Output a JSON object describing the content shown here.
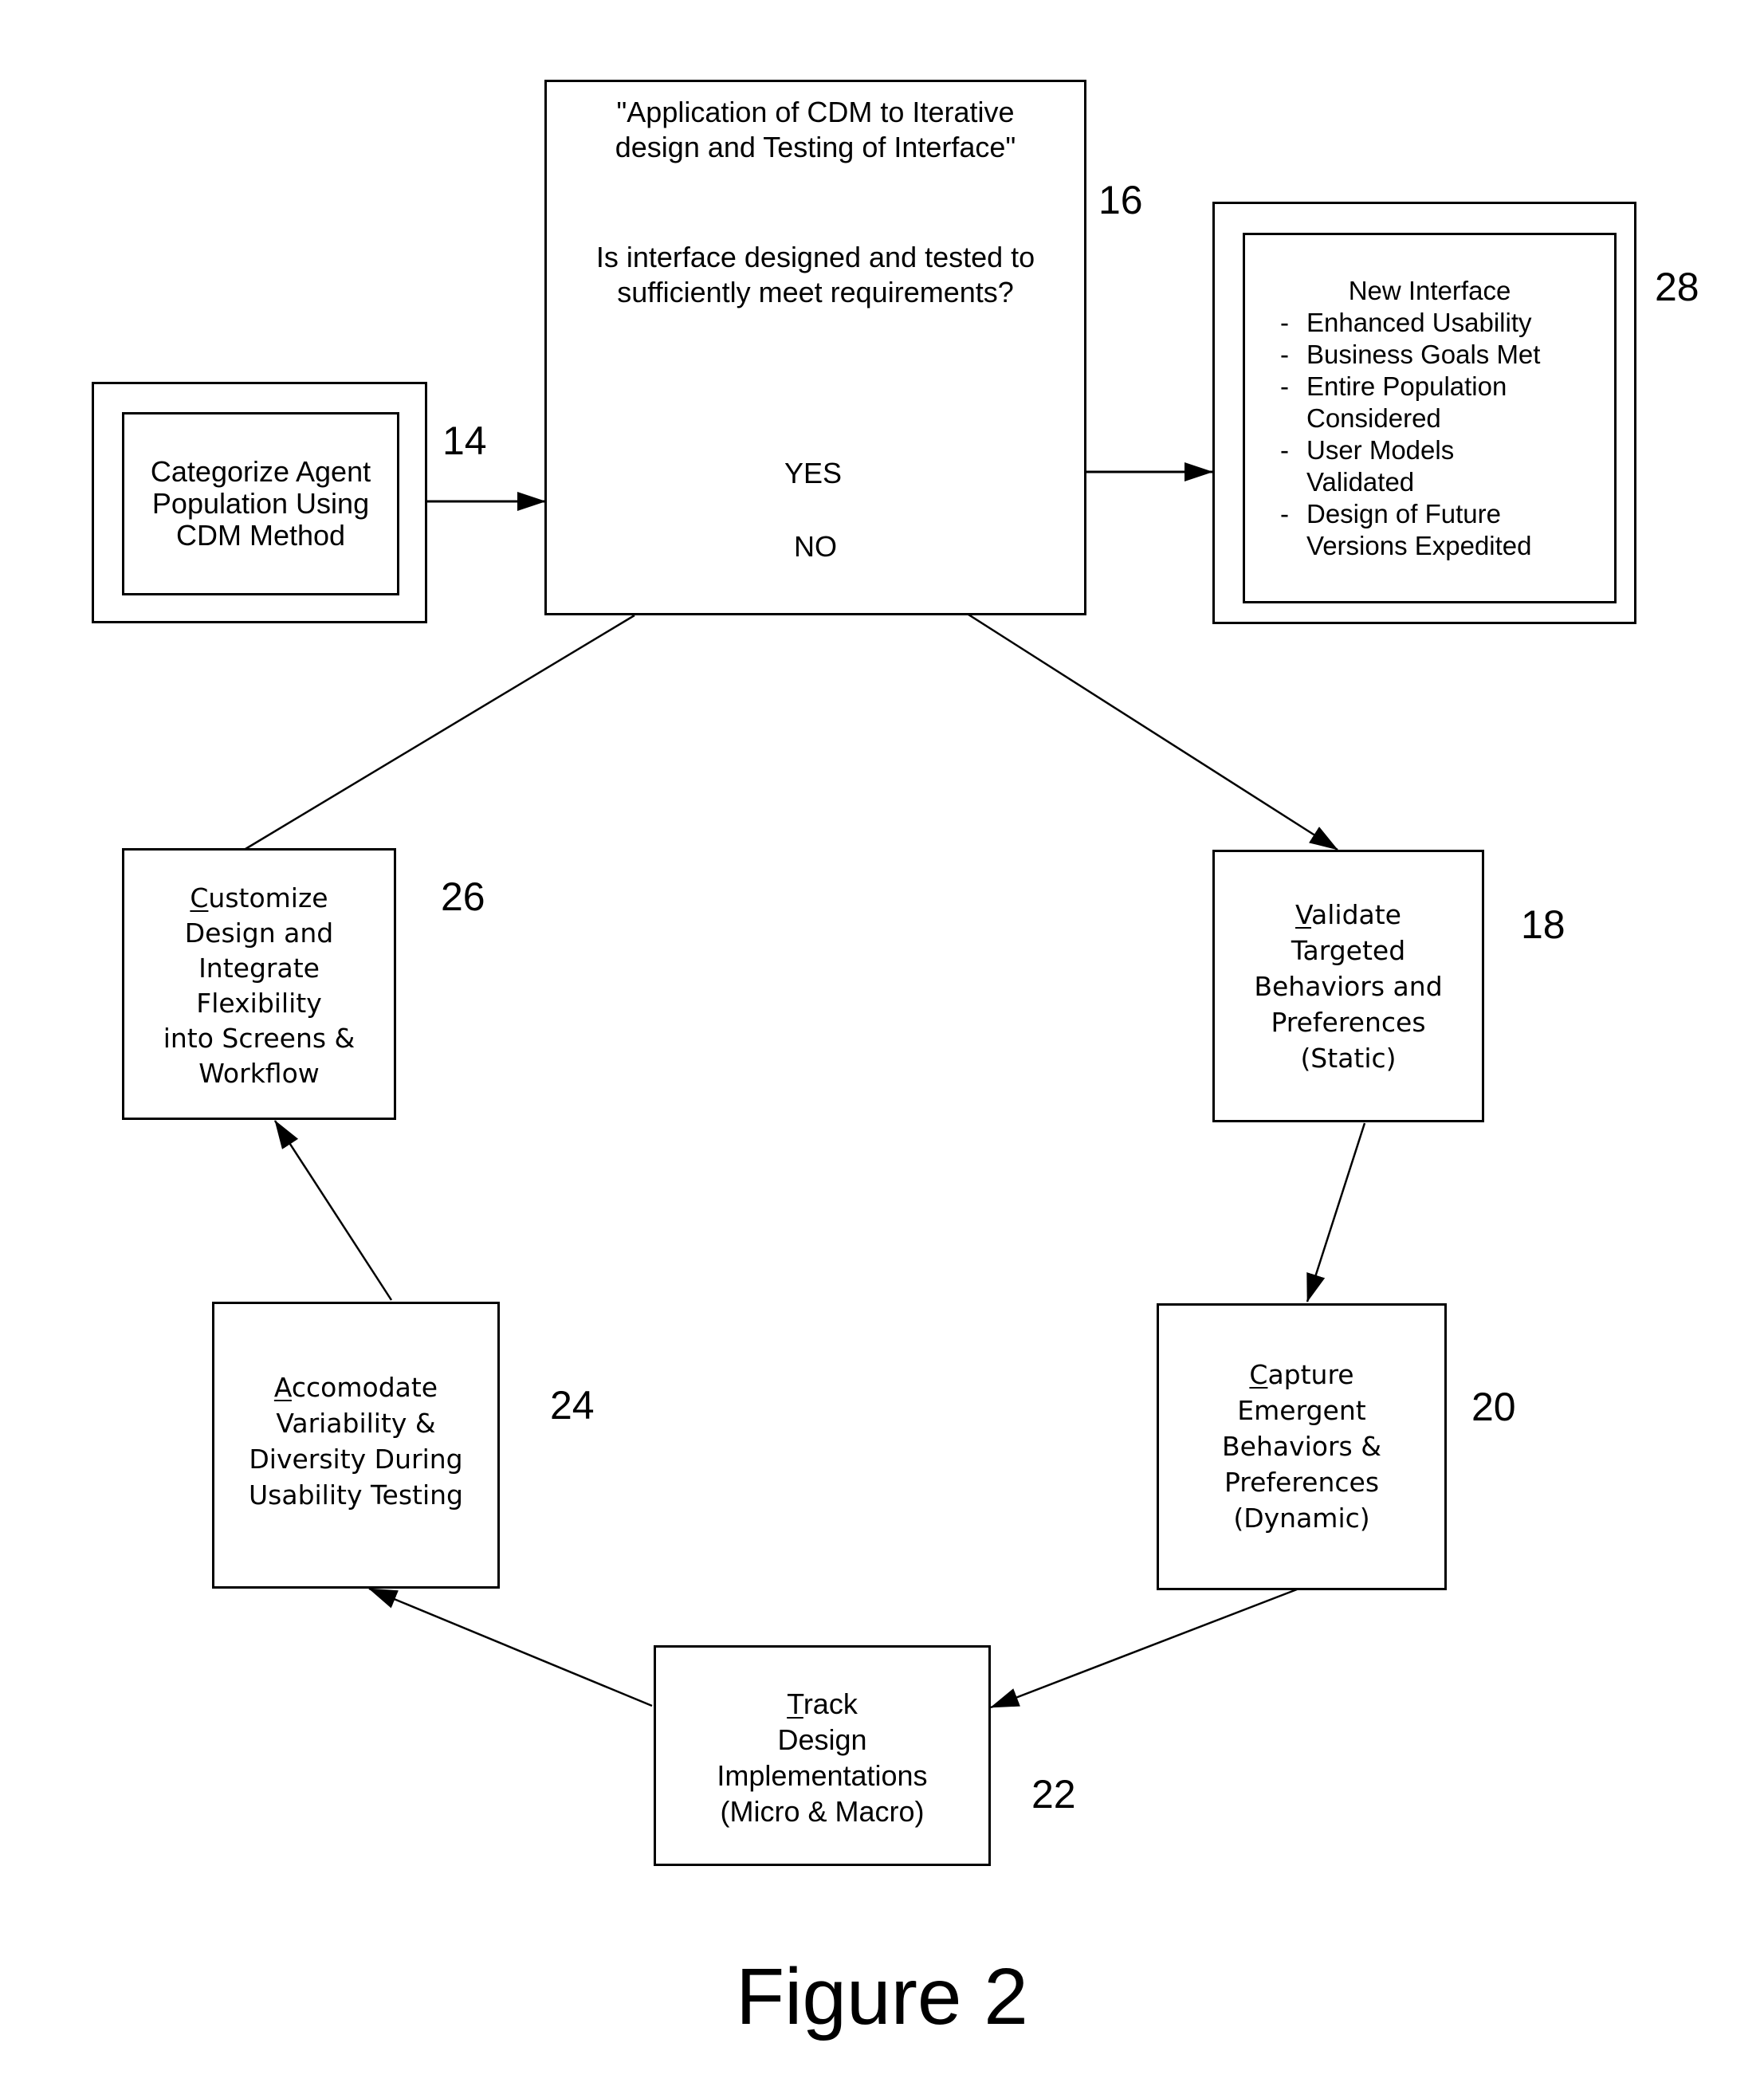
{
  "figure_caption": "Figure 2",
  "nodes": {
    "n14": {
      "ref": "14",
      "lines": [
        "Categorize Agent",
        "Population Using",
        "CDM Method"
      ]
    },
    "n16": {
      "ref": "16",
      "title_lines": [
        "\"Application of CDM to Iterative",
        "design and Testing of Interface\""
      ],
      "question_lines": [
        "Is interface designed and tested to",
        "sufficiently meet requirements?"
      ],
      "yes_label": "YES",
      "no_label": "NO"
    },
    "n28": {
      "ref": "28",
      "heading": "New Interface",
      "items": [
        {
          "dash": "-",
          "text": "Enhanced Usability"
        },
        {
          "dash": "-",
          "text": "Business Goals Met"
        },
        {
          "dash": "-",
          "text": "Entire Population"
        },
        {
          "dash": "",
          "text": "Considered"
        },
        {
          "dash": "-",
          "text": "User Models"
        },
        {
          "dash": "",
          "text": "Validated"
        },
        {
          "dash": "-",
          "text": "Design of Future"
        },
        {
          "dash": "",
          "text": "Versions Expedited"
        }
      ]
    },
    "n18": {
      "ref": "18",
      "first_letter": "V",
      "first_rest": "alidate",
      "lines": [
        "Targeted",
        "Behaviors and",
        "Preferences",
        "(Static)"
      ]
    },
    "n20": {
      "ref": "20",
      "first_letter": "C",
      "first_rest": "apture",
      "lines": [
        "Emergent",
        "Behaviors &",
        "Preferences",
        "(Dynamic)"
      ]
    },
    "n22": {
      "ref": "22",
      "first_letter": "T",
      "first_rest": "rack",
      "lines": [
        "Design",
        "Implementations",
        "(Micro & Macro)"
      ]
    },
    "n24": {
      "ref": "24",
      "first_letter": "A",
      "first_rest": "ccomodate",
      "lines": [
        "Variability &",
        "Diversity During",
        "Usability Testing"
      ]
    },
    "n26": {
      "ref": "26",
      "first_letter": "C",
      "first_rest": "ustomize",
      "lines": [
        "Design and",
        "Integrate",
        "Flexibility",
        "into Screens &",
        "Workflow"
      ]
    }
  }
}
